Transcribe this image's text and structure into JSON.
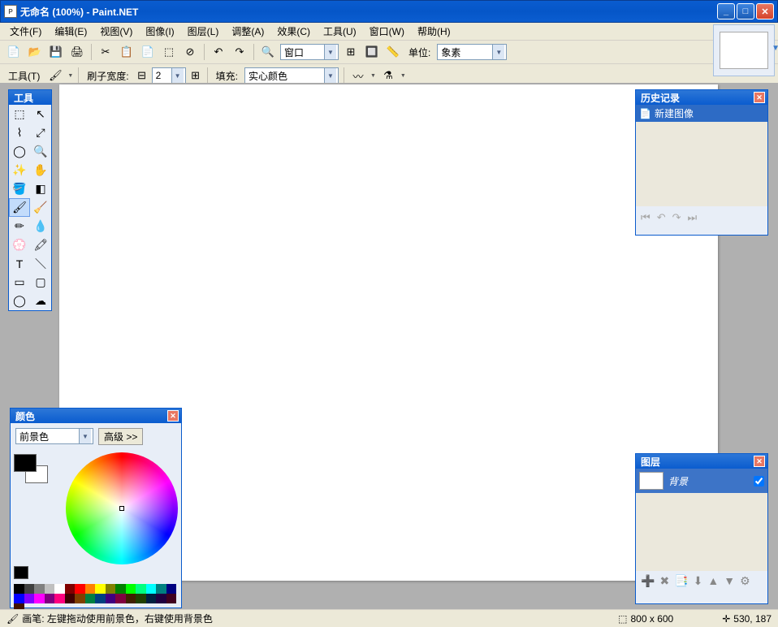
{
  "titlebar": {
    "title": "无命名 (100%) - Paint.NET"
  },
  "menu": {
    "file": "文件(F)",
    "edit": "编辑(E)",
    "view": "视图(V)",
    "image": "图像(I)",
    "layers": "图层(L)",
    "adjust": "调整(A)",
    "effects": "效果(C)",
    "tools": "工具(U)",
    "window": "窗口(W)",
    "help": "帮助(H)"
  },
  "toolbar1": {
    "zoom_mode": "窗口",
    "units_label": "单位:",
    "units_value": "象素"
  },
  "toolbar2": {
    "tool_label": "工具(T)",
    "brush_label": "刷子宽度:",
    "brush_value": "2",
    "fill_label": "填充:",
    "fill_value": "实心颜色"
  },
  "tools_panel": {
    "title": "工具"
  },
  "colors_panel": {
    "title": "颜色",
    "target": "前景色",
    "advanced": "高级 >>"
  },
  "history_panel": {
    "title": "历史记录",
    "item1": "新建图像"
  },
  "layers_panel": {
    "title": "图层",
    "bg_layer": "背景"
  },
  "status": {
    "hint": "画笔: 左键拖动使用前景色，右键使用背景色",
    "size": "800 x 600",
    "pos": "530, 187"
  },
  "palette": [
    "#000",
    "#404040",
    "#808080",
    "#c0c0c0",
    "#fff",
    "#800000",
    "#f00",
    "#ff8000",
    "#ff0",
    "#808000",
    "#008000",
    "#0f0",
    "#00ff80",
    "#0ff",
    "#008080",
    "#000080",
    "#00f",
    "#8000ff",
    "#f0f",
    "#800080",
    "#ff0080",
    "#400000",
    "#804000",
    "#008040",
    "#004080",
    "#400080",
    "#800040",
    "#402000",
    "#204000",
    "#002040",
    "#200040",
    "#400020",
    "#401000"
  ]
}
